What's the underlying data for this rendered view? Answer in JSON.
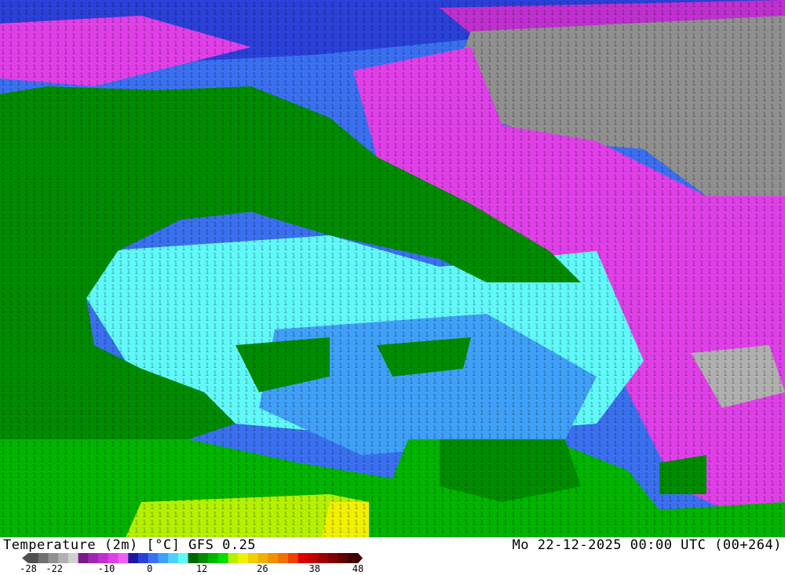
{
  "footer": {
    "title": "Temperature (2m) [°C] GFS 0.25",
    "valid": "Mo 22-12-2025 00:00 UTC (00+264)"
  },
  "colorbar": {
    "colors": [
      "#505050",
      "#707070",
      "#909090",
      "#b0b0b0",
      "#d0d0d0",
      "#7a1a8a",
      "#9c28b0",
      "#c030d0",
      "#e040e8",
      "#f060f0",
      "#1a1aa0",
      "#2a40d8",
      "#3a70f0",
      "#40a0f8",
      "#50d0f8",
      "#60f8f8",
      "#006400",
      "#008c00",
      "#00b400",
      "#00dc00",
      "#b4f000",
      "#f0f000",
      "#f0d000",
      "#f0b000",
      "#f09000",
      "#f07000",
      "#f04000",
      "#e00000",
      "#c00000",
      "#a00000",
      "#800000",
      "#600000",
      "#400000"
    ],
    "ticks": [
      {
        "label": "-28",
        "value": -28
      },
      {
        "label": "-22",
        "value": -22
      },
      {
        "label": "-10",
        "value": -10
      },
      {
        "label": "0",
        "value": 0
      },
      {
        "label": "12",
        "value": 12
      },
      {
        "label": "26",
        "value": 26
      },
      {
        "label": "38",
        "value": 38
      },
      {
        "label": "48",
        "value": 48
      }
    ],
    "min": -28,
    "max": 48
  }
}
